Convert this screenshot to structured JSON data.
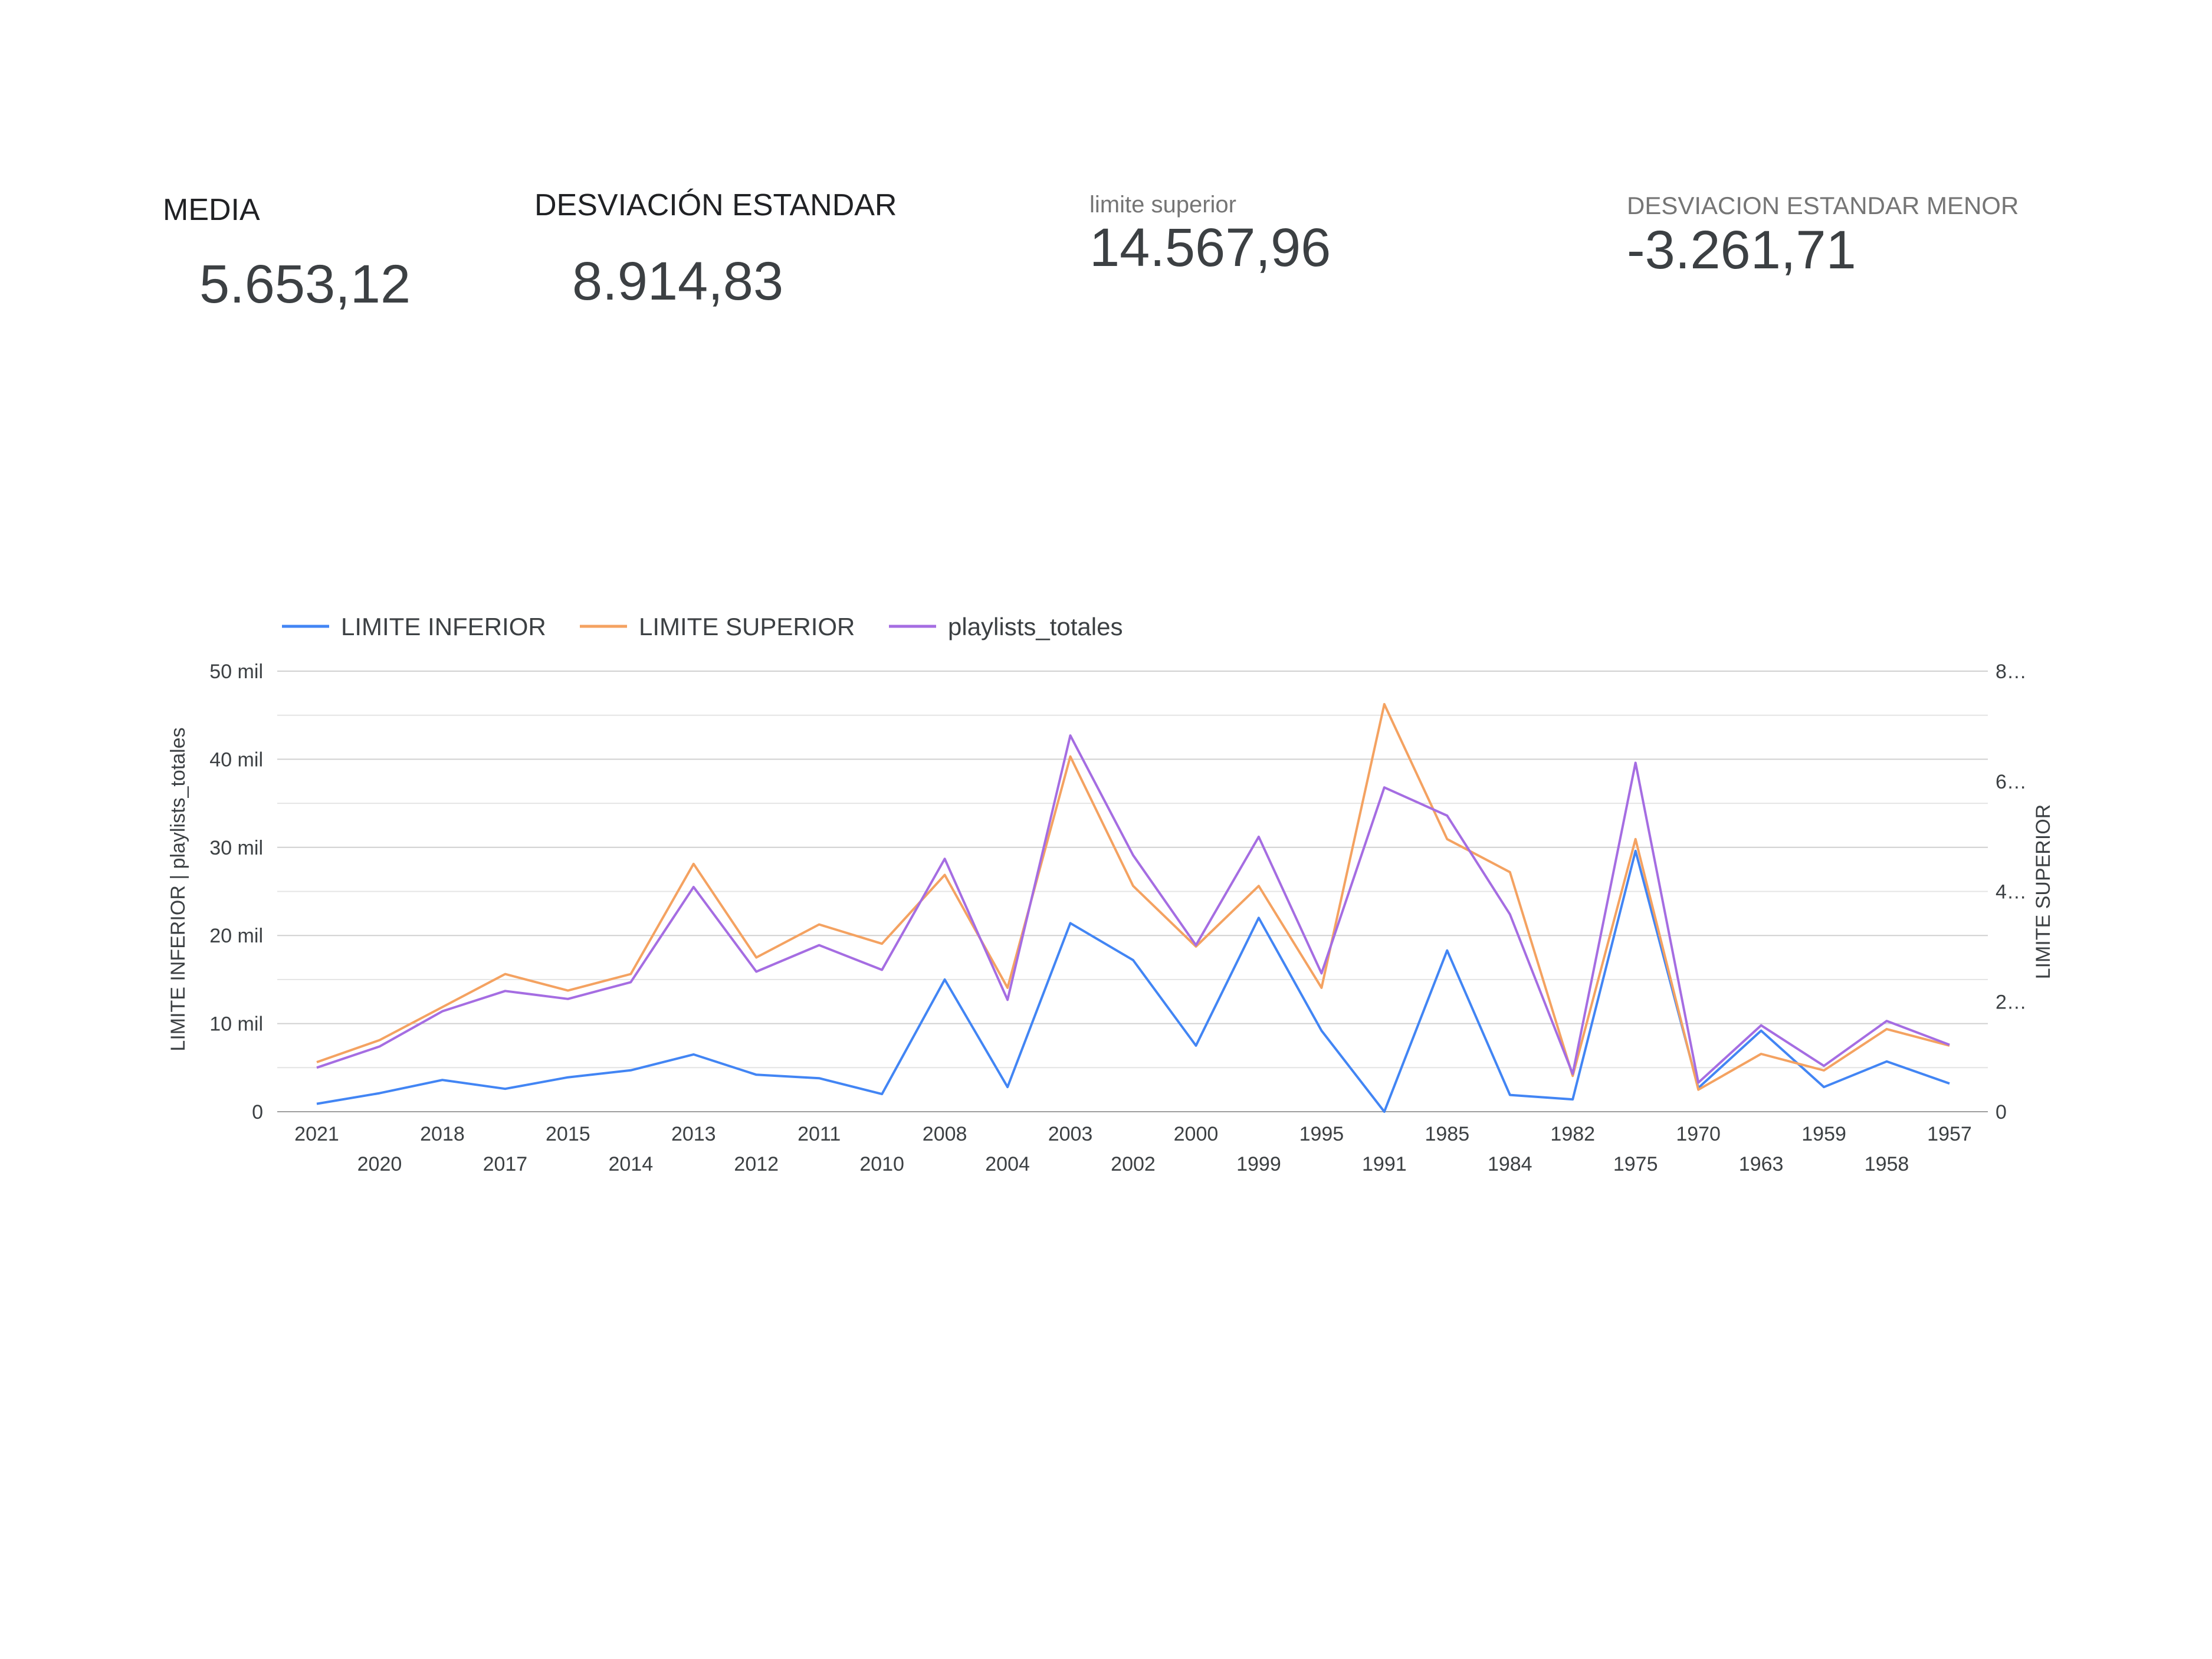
{
  "kpis": [
    {
      "label": "MEDIA",
      "value": "5.653,12"
    },
    {
      "label": "DESVIACIÓN ESTANDAR",
      "value": "8.914,83"
    },
    {
      "label": "limite superior",
      "value": "14.567,96"
    },
    {
      "label": "DESVIACION ESTANDAR MENOR",
      "value": "-3.261,71"
    }
  ],
  "chart_data": {
    "type": "line",
    "categories": [
      "2021",
      "2020",
      "2018",
      "2017",
      "2015",
      "2014",
      "2013",
      "2012",
      "2011",
      "2010",
      "2008",
      "2004",
      "2003",
      "2002",
      "2000",
      "1999",
      "1995",
      "1991",
      "1985",
      "1984",
      "1982",
      "1975",
      "1970",
      "1963",
      "1959",
      "1958",
      "1957"
    ],
    "x_labels_row1": [
      "2021",
      "2018",
      "2015",
      "2013",
      "2011",
      "2008",
      "2003",
      "2000",
      "1995",
      "1985",
      "1982",
      "1970",
      "1959",
      "1957"
    ],
    "x_labels_row2": [
      "2020",
      "2017",
      "2014",
      "2012",
      "2010",
      "2004",
      "2002",
      "1999",
      "1991",
      "1984",
      "1975",
      "1963",
      "1958"
    ],
    "series": [
      {
        "name": "LIMITE INFERIOR",
        "color": "#4285f4",
        "axis": "left",
        "values": [
          900,
          2100,
          3600,
          2600,
          3900,
          4700,
          6500,
          4200,
          3800,
          2000,
          15000,
          2800,
          21400,
          17200,
          7500,
          22000,
          9200,
          0,
          18300,
          1900,
          1400,
          29600,
          2700,
          9200,
          2800,
          5700,
          3200
        ]
      },
      {
        "name": "LIMITE SUPERIOR",
        "color": "#f4a261",
        "axis": "right",
        "values": [
          900,
          1300,
          1900,
          2500,
          2200,
          2500,
          4500,
          2800,
          3400,
          3050,
          4300,
          2250,
          6450,
          4100,
          3000,
          4100,
          2250,
          7400,
          4950,
          4350,
          650,
          4950,
          400,
          1050,
          750,
          1500,
          1200
        ]
      },
      {
        "name": "playlists_totales",
        "color": "#a56de2",
        "axis": "left",
        "values": [
          5000,
          7400,
          11400,
          13700,
          12800,
          14700,
          25500,
          15900,
          18900,
          16100,
          28700,
          12700,
          42700,
          29100,
          18900,
          31200,
          15700,
          36800,
          33600,
          22400,
          4300,
          39600,
          3300,
          9800,
          5200,
          10300,
          7600
        ]
      }
    ],
    "left_axis": {
      "title": "LIMITE INFERIOR | playlists_totales",
      "ylim": [
        0,
        50000
      ],
      "ticks": [
        0,
        10000,
        20000,
        30000,
        40000,
        50000
      ],
      "tick_labels": [
        "0",
        "10 mil",
        "20 mil",
        "30 mil",
        "40 mil",
        "50 mil"
      ]
    },
    "right_axis": {
      "title": "LIMITE SUPERIOR",
      "ylim": [
        0,
        8000
      ],
      "ticks": [
        0,
        2000,
        4000,
        6000,
        8000
      ],
      "tick_labels": [
        "0",
        "2…",
        "4…",
        "6…",
        "8…"
      ]
    },
    "grid": true,
    "legend_position": "top-left"
  }
}
